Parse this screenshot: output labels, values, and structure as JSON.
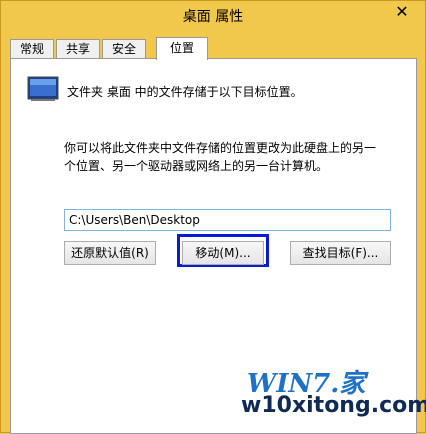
{
  "window": {
    "title": "桌面 属性",
    "close_glyph": "✕"
  },
  "tabs": [
    {
      "label": "常规"
    },
    {
      "label": "共享"
    },
    {
      "label": "安全"
    },
    {
      "label": "位置"
    }
  ],
  "location": {
    "info": "文件夹 桌面 中的文件存储于以下目标位置。",
    "description": "你可以将此文件夹中文件存储的位置更改为此硬盘上的另一个位置、另一个驱动器或网络上的另一台计算机。",
    "path_value": "C:\\Users\\Ben\\Desktop",
    "buttons": {
      "restore_default": "还原默认值(R)",
      "move": "移动(M)...",
      "find_target": "查找目标(F)..."
    }
  },
  "watermark": {
    "brand": "WIN7.家",
    "site": "w10xitong.com"
  },
  "colors": {
    "frame": "#f1c84b",
    "highlight": "#0a1bd6",
    "input_border": "#7fb4dd"
  }
}
